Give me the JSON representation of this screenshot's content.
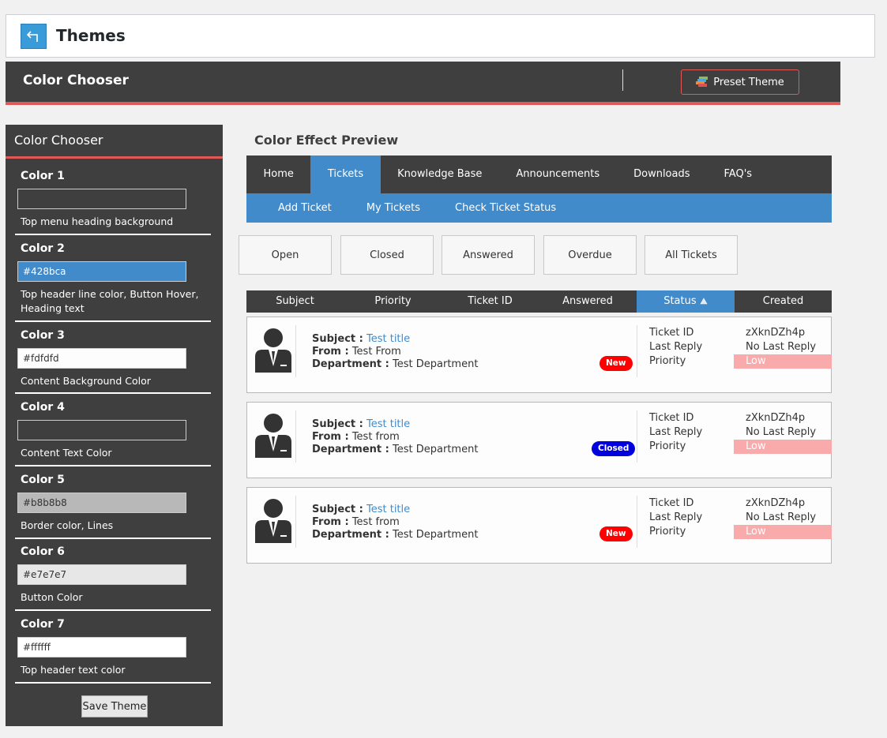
{
  "page": {
    "title": "Themes"
  },
  "header": {
    "title": "Color Chooser",
    "preset_label": "Preset Theme"
  },
  "sidebar": {
    "title": "Color Chooser",
    "colors": [
      {
        "label": "Color 1",
        "value": "",
        "color": "#3f3f3f",
        "description": "Top menu heading background"
      },
      {
        "label": "Color 2",
        "value": "#428bca",
        "color": "#428bca",
        "description": "Top header line color, Button Hover, Heading text"
      },
      {
        "label": "Color 3",
        "value": "#fdfdfd",
        "color": "#fdfdfd",
        "description": "Content Background Color"
      },
      {
        "label": "Color 4",
        "value": "",
        "color": "#3f3f3f",
        "description": "Content Text Color"
      },
      {
        "label": "Color 5",
        "value": "#b8b8b8",
        "color": "#b8b8b8",
        "description": "Border color, Lines"
      },
      {
        "label": "Color 6",
        "value": "#e7e7e7",
        "color": "#e7e7e7",
        "description": "Button Color"
      },
      {
        "label": "Color 7",
        "value": "#ffffff",
        "color": "#ffffff",
        "description": "Top header text color"
      }
    ],
    "save_label": "Save Theme"
  },
  "preview": {
    "title": "Color Effect Preview",
    "nav": [
      "Home",
      "Tickets",
      "Knowledge Base",
      "Announcements",
      "Downloads",
      "FAQ's"
    ],
    "nav_active": "Tickets",
    "subnav": [
      "Add Ticket",
      "My Tickets",
      "Check Ticket Status"
    ],
    "filters": [
      "Open",
      "Closed",
      "Answered",
      "Overdue",
      "All Tickets"
    ],
    "columns": [
      "Subject",
      "Priority",
      "Ticket ID",
      "Answered",
      "Status",
      "Created"
    ],
    "active_column": "Status",
    "field_labels": {
      "subject": "Subject :",
      "from": "From :",
      "department": "Department :",
      "ticket_id": "Ticket ID",
      "last_reply": "Last Reply",
      "priority": "Priority"
    },
    "tickets": [
      {
        "subject": "Test title",
        "from": "Test From",
        "department": "Test Department",
        "status": "New",
        "ticket_id": "zXknDZh4p",
        "last_reply": "No Last Reply",
        "priority": "Low"
      },
      {
        "subject": "Test title",
        "from": "Test from",
        "department": "Test Department",
        "status": "Closed",
        "ticket_id": "zXknDZh4p",
        "last_reply": "No Last Reply",
        "priority": "Low"
      },
      {
        "subject": "Test title",
        "from": "Test from",
        "department": "Test Department",
        "status": "New",
        "ticket_id": "zXknDZh4p",
        "last_reply": "No Last Reply",
        "priority": "Low"
      }
    ]
  },
  "colors": {
    "dark": "#3f3f3f",
    "accent": "#428bca",
    "red_line": "#e15858",
    "badge_new": "#ff0000",
    "badge_closed": "#0000dd",
    "priority_low": "#f9aaaa"
  },
  "icons": [
    "back-arrow-icon",
    "preset-theme-icon",
    "sort-asc-icon",
    "user-avatar-icon"
  ]
}
